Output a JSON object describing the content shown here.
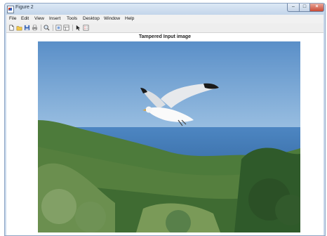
{
  "window": {
    "title": "Figure 2"
  },
  "menubar": [
    "File",
    "Edit",
    "View",
    "Insert",
    "Tools",
    "Desktop",
    "Window",
    "Help"
  ],
  "toolbar": [
    "new-figure-icon",
    "open-folder-icon",
    "save-icon",
    "print-icon",
    "zoom-icon",
    "link-plot-icon",
    "property-editor-icon",
    "pointer-icon",
    "insert-legend-icon"
  ],
  "figure": {
    "title": "Tampered Input image"
  },
  "colors": {
    "titlebar": "#c9d9ec",
    "sky": "#5b8fc6",
    "sea": "#3f79b8",
    "hills": "#4c7a3a",
    "close_button": "#c84a35"
  }
}
